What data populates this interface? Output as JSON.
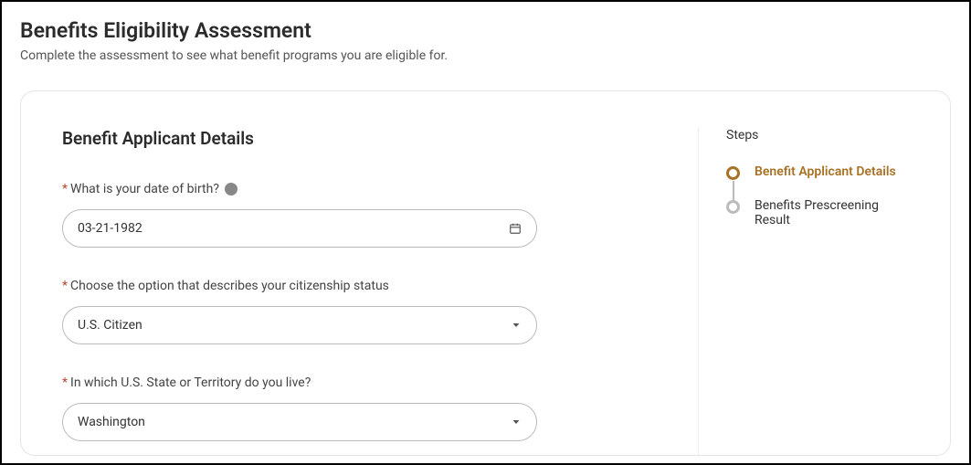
{
  "header": {
    "title": "Benefits Eligibility Assessment",
    "subtitle": "Complete the assessment to see what benefit programs you are eligible for."
  },
  "form": {
    "section_heading": "Benefit Applicant Details",
    "dob": {
      "label": "What is your date of birth?",
      "value": "03-21-1982"
    },
    "citizenship": {
      "label": "Choose the option that describes your citizenship status",
      "value": "U.S. Citizen"
    },
    "state": {
      "label": "In which U.S. State or Territory do you live?",
      "value": "Washington"
    }
  },
  "steps": {
    "heading": "Steps",
    "items": [
      {
        "label": "Benefit Applicant Details",
        "active": true
      },
      {
        "label": "Benefits Prescreening Result",
        "active": false
      }
    ]
  }
}
